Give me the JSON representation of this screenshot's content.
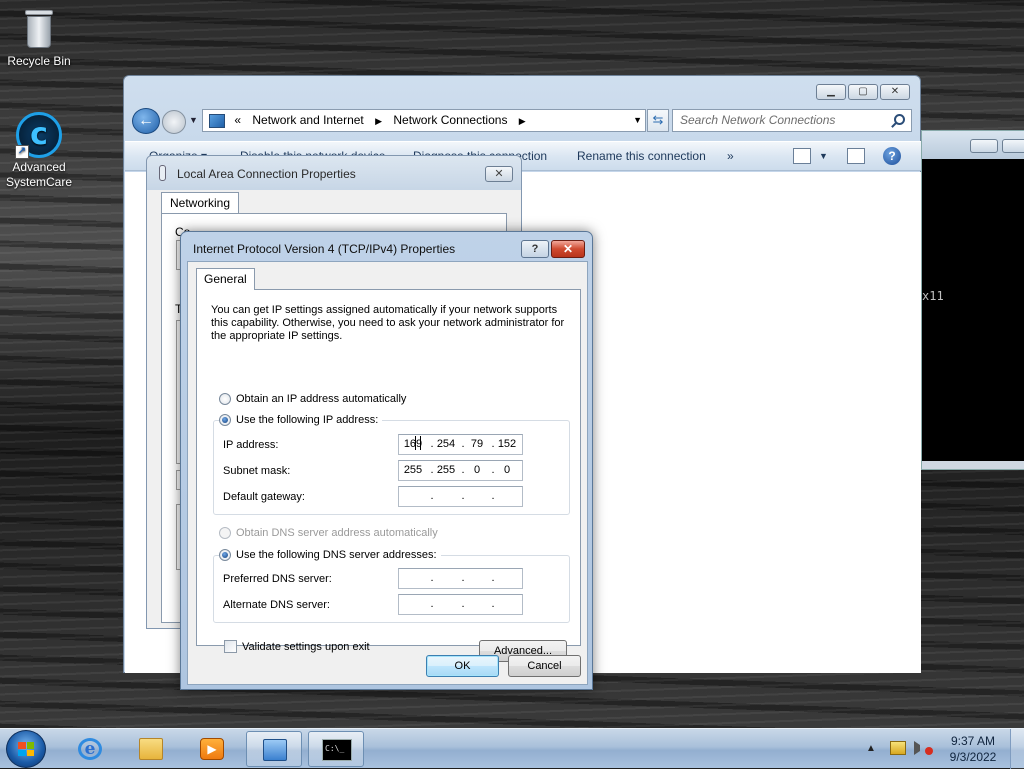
{
  "desktop": {
    "icons": [
      {
        "label": "Recycle Bin"
      },
      {
        "label": "Advanced SystemCare"
      }
    ]
  },
  "console": {
    "visible_text": "x11"
  },
  "explorer": {
    "breadcrumb": {
      "overflow": "«",
      "items": [
        "Network and Internet",
        "Network Connections"
      ]
    },
    "search_placeholder": "Search Network Connections",
    "toolbar": {
      "organize": "Organize ▾",
      "disable": "Disable this network device",
      "diagnose": "Diagnose this connection",
      "rename": "Rename this connection",
      "more": "»"
    }
  },
  "lac_dialog": {
    "title": "Local Area Connection Properties",
    "tab": "Networking",
    "partial_text_1": "Co",
    "partial_text_2": "T"
  },
  "ipv4_dialog": {
    "title": "Internet Protocol Version 4 (TCP/IPv4) Properties",
    "help_label": "?",
    "close_label": "✕",
    "tab": "General",
    "description": "You can get IP settings assigned automatically if your network supports this capability. Otherwise, you need to ask your network administrator for the appropriate IP settings.",
    "radio_auto_ip": "Obtain an IP address automatically",
    "radio_manual_ip": "Use the following IP address:",
    "ip_label": "IP address:",
    "ip_value": [
      "169",
      "254",
      "79",
      "152"
    ],
    "subnet_label": "Subnet mask:",
    "subnet_value": [
      "255",
      "255",
      "0",
      "0"
    ],
    "gateway_label": "Default gateway:",
    "radio_auto_dns": "Obtain DNS server address automatically",
    "radio_manual_dns": "Use the following DNS server addresses:",
    "preferred_dns_label": "Preferred DNS server:",
    "alternate_dns_label": "Alternate DNS server:",
    "validate_label": "Validate settings upon exit",
    "advanced_label": "Advanced...",
    "ok_label": "OK",
    "cancel_label": "Cancel"
  },
  "taskbar": {
    "clock_time": "9:37 AM",
    "clock_date": "9/3/2022",
    "cmd_glyph_text": "C:\\_",
    "media_glyph_text": "▶",
    "ie_glyph_text": "e",
    "tray_arrow": "▲"
  }
}
